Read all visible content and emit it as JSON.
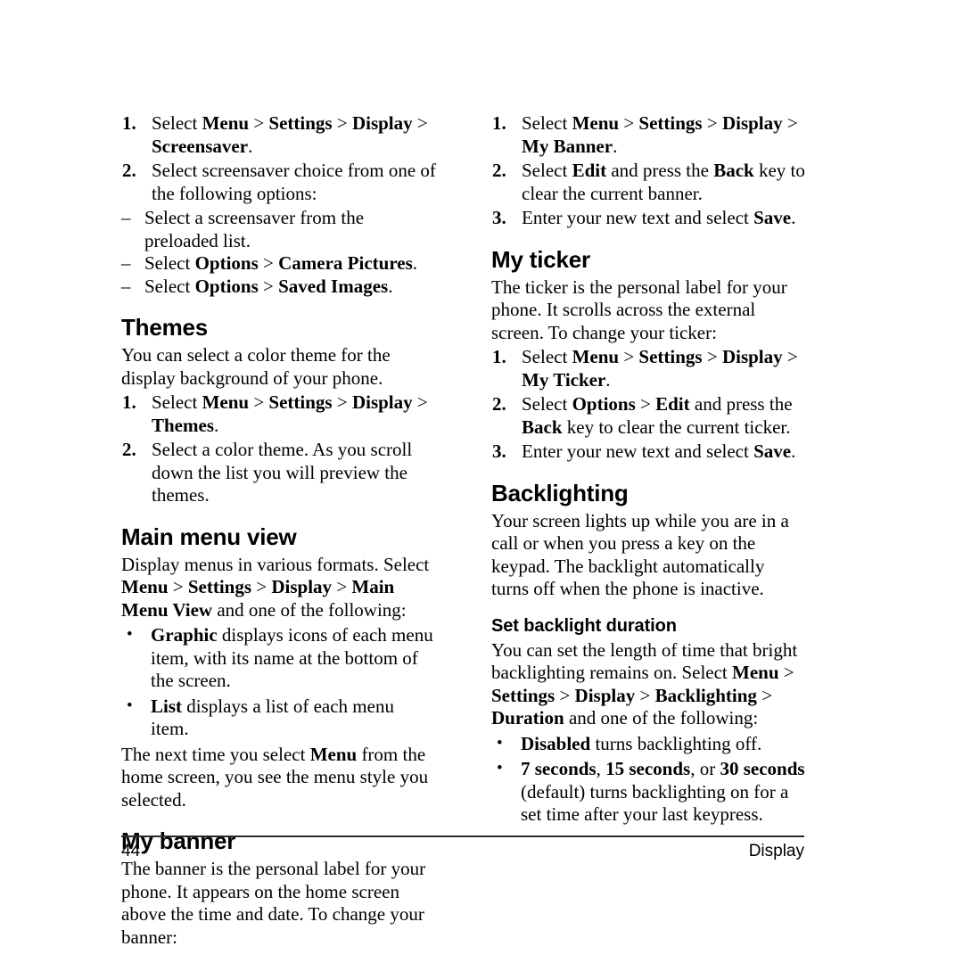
{
  "page": {
    "number": "44",
    "footer_section": "Display"
  },
  "left_column": {
    "screensaver_steps": [
      {
        "num": "1.",
        "parts": [
          {
            "t": "Select ",
            "b": false
          },
          {
            "t": "Menu",
            "b": true
          },
          {
            "t": " > ",
            "b": false
          },
          {
            "t": "Settings",
            "b": true
          },
          {
            "t": " > ",
            "b": false
          },
          {
            "t": "Display",
            "b": true
          },
          {
            "t": " > ",
            "b": false
          },
          {
            "t": "Screensaver",
            "b": true
          },
          {
            "t": ".",
            "b": false
          }
        ]
      },
      {
        "num": "2.",
        "parts": [
          {
            "t": "Select screensaver choice from one of the following options:",
            "b": false
          }
        ]
      }
    ],
    "screensaver_dashes": [
      {
        "dash": "–",
        "parts": [
          {
            "t": "Select a screensaver from the preloaded list.",
            "b": false
          }
        ]
      },
      {
        "dash": "–",
        "parts": [
          {
            "t": "Select ",
            "b": false
          },
          {
            "t": "Options",
            "b": true
          },
          {
            "t": " > ",
            "b": false
          },
          {
            "t": "Camera Pictures",
            "b": true
          },
          {
            "t": ".",
            "b": false
          }
        ]
      },
      {
        "dash": "–",
        "parts": [
          {
            "t": "Select ",
            "b": false
          },
          {
            "t": "Options",
            "b": true
          },
          {
            "t": " > ",
            "b": false
          },
          {
            "t": "Saved Images",
            "b": true
          },
          {
            "t": ".",
            "b": false
          }
        ]
      }
    ],
    "themes": {
      "heading": "Themes",
      "intro": "You can select a color theme for the display background of your phone.",
      "steps": [
        {
          "num": "1.",
          "parts": [
            {
              "t": "Select ",
              "b": false
            },
            {
              "t": "Menu",
              "b": true
            },
            {
              "t": " > ",
              "b": false
            },
            {
              "t": "Settings",
              "b": true
            },
            {
              "t": " > ",
              "b": false
            },
            {
              "t": "Display",
              "b": true
            },
            {
              "t": " > ",
              "b": false
            },
            {
              "t": "Themes",
              "b": true
            },
            {
              "t": ".",
              "b": false
            }
          ]
        },
        {
          "num": "2.",
          "parts": [
            {
              "t": "Select a color theme. As you scroll down the list you will preview the themes.",
              "b": false
            }
          ]
        }
      ]
    },
    "main_menu_view": {
      "heading": "Main menu view",
      "intro_parts": [
        {
          "t": "Display menus in various formats. Select ",
          "b": false
        },
        {
          "t": "Menu",
          "b": true
        },
        {
          "t": " > ",
          "b": false
        },
        {
          "t": "Settings",
          "b": true
        },
        {
          "t": " > ",
          "b": false
        },
        {
          "t": "Display",
          "b": true
        },
        {
          "t": " > ",
          "b": false
        },
        {
          "t": "Main Menu View",
          "b": true
        },
        {
          "t": " and one of the following:",
          "b": false
        }
      ],
      "bullets": [
        {
          "bullet": "•",
          "parts": [
            {
              "t": "Graphic",
              "b": true
            },
            {
              "t": " displays icons of each menu item, with its name at the bottom of the screen.",
              "b": false
            }
          ]
        },
        {
          "bullet": "•",
          "parts": [
            {
              "t": "List",
              "b": true
            },
            {
              "t": " displays a list of each menu item.",
              "b": false
            }
          ]
        }
      ],
      "outro_parts": [
        {
          "t": "The next time you select ",
          "b": false
        },
        {
          "t": "Menu",
          "b": true
        },
        {
          "t": " from the home screen, you see the menu style you selected.",
          "b": false
        }
      ]
    },
    "my_banner": {
      "heading": "My banner",
      "intro": "The banner is the personal label for your phone. It appears on the home screen above the time and date. To change your banner:"
    }
  },
  "right_column": {
    "my_banner_steps": [
      {
        "num": "1.",
        "parts": [
          {
            "t": "Select ",
            "b": false
          },
          {
            "t": "Menu",
            "b": true
          },
          {
            "t": " > ",
            "b": false
          },
          {
            "t": "Settings",
            "b": true
          },
          {
            "t": " > ",
            "b": false
          },
          {
            "t": "Display",
            "b": true
          },
          {
            "t": " > ",
            "b": false
          },
          {
            "t": "My Banner",
            "b": true
          },
          {
            "t": ".",
            "b": false
          }
        ]
      },
      {
        "num": "2.",
        "parts": [
          {
            "t": "Select ",
            "b": false
          },
          {
            "t": "Edit",
            "b": true
          },
          {
            "t": " and press the ",
            "b": false
          },
          {
            "t": "Back",
            "b": true
          },
          {
            "t": " key to clear the current banner.",
            "b": false
          }
        ]
      },
      {
        "num": "3.",
        "parts": [
          {
            "t": "Enter your new text and select ",
            "b": false
          },
          {
            "t": "Save",
            "b": true
          },
          {
            "t": ".",
            "b": false
          }
        ]
      }
    ],
    "my_ticker": {
      "heading": "My ticker",
      "intro": "The ticker is the personal label for your phone. It scrolls across the external screen. To change your ticker:",
      "steps": [
        {
          "num": "1.",
          "parts": [
            {
              "t": "Select ",
              "b": false
            },
            {
              "t": "Menu",
              "b": true
            },
            {
              "t": " > ",
              "b": false
            },
            {
              "t": "Settings",
              "b": true
            },
            {
              "t": " > ",
              "b": false
            },
            {
              "t": "Display",
              "b": true
            },
            {
              "t": " > ",
              "b": false
            },
            {
              "t": "My Ticker",
              "b": true
            },
            {
              "t": ".",
              "b": false
            }
          ]
        },
        {
          "num": "2.",
          "parts": [
            {
              "t": "Select ",
              "b": false
            },
            {
              "t": "Options",
              "b": true
            },
            {
              "t": " > ",
              "b": false
            },
            {
              "t": "Edit",
              "b": true
            },
            {
              "t": " and press the ",
              "b": false
            },
            {
              "t": "Back",
              "b": true
            },
            {
              "t": " key to clear the current ticker.",
              "b": false
            }
          ]
        },
        {
          "num": "3.",
          "parts": [
            {
              "t": "Enter your new text and select ",
              "b": false
            },
            {
              "t": "Save",
              "b": true
            },
            {
              "t": ".",
              "b": false
            }
          ]
        }
      ]
    },
    "backlighting": {
      "heading": "Backlighting",
      "intro": "Your screen lights up while you are in a call or when you press a key on the keypad. The backlight automatically turns off when the phone is inactive.",
      "sub_heading": "Set backlight duration",
      "sub_intro_parts": [
        {
          "t": "You can set the length of time that bright backlighting remains on. Select ",
          "b": false
        },
        {
          "t": "Menu",
          "b": true
        },
        {
          "t": " > ",
          "b": false
        },
        {
          "t": "Settings",
          "b": true
        },
        {
          "t": " > ",
          "b": false
        },
        {
          "t": "Display",
          "b": true
        },
        {
          "t": " > ",
          "b": false
        },
        {
          "t": "Backlighting",
          "b": true
        },
        {
          "t": " > ",
          "b": false
        },
        {
          "t": "Duration",
          "b": true
        },
        {
          "t": " and one of the following:",
          "b": false
        }
      ],
      "bullets": [
        {
          "bullet": "•",
          "parts": [
            {
              "t": "Disabled",
              "b": true
            },
            {
              "t": " turns backlighting off.",
              "b": false
            }
          ]
        },
        {
          "bullet": "•",
          "parts": [
            {
              "t": "7 seconds",
              "b": true
            },
            {
              "t": ", ",
              "b": false
            },
            {
              "t": "15 seconds",
              "b": true
            },
            {
              "t": ", or ",
              "b": false
            },
            {
              "t": "30 seconds",
              "b": true
            },
            {
              "t": " (default) turns backlighting on for a set time after your last keypress.",
              "b": false
            }
          ]
        }
      ]
    }
  }
}
